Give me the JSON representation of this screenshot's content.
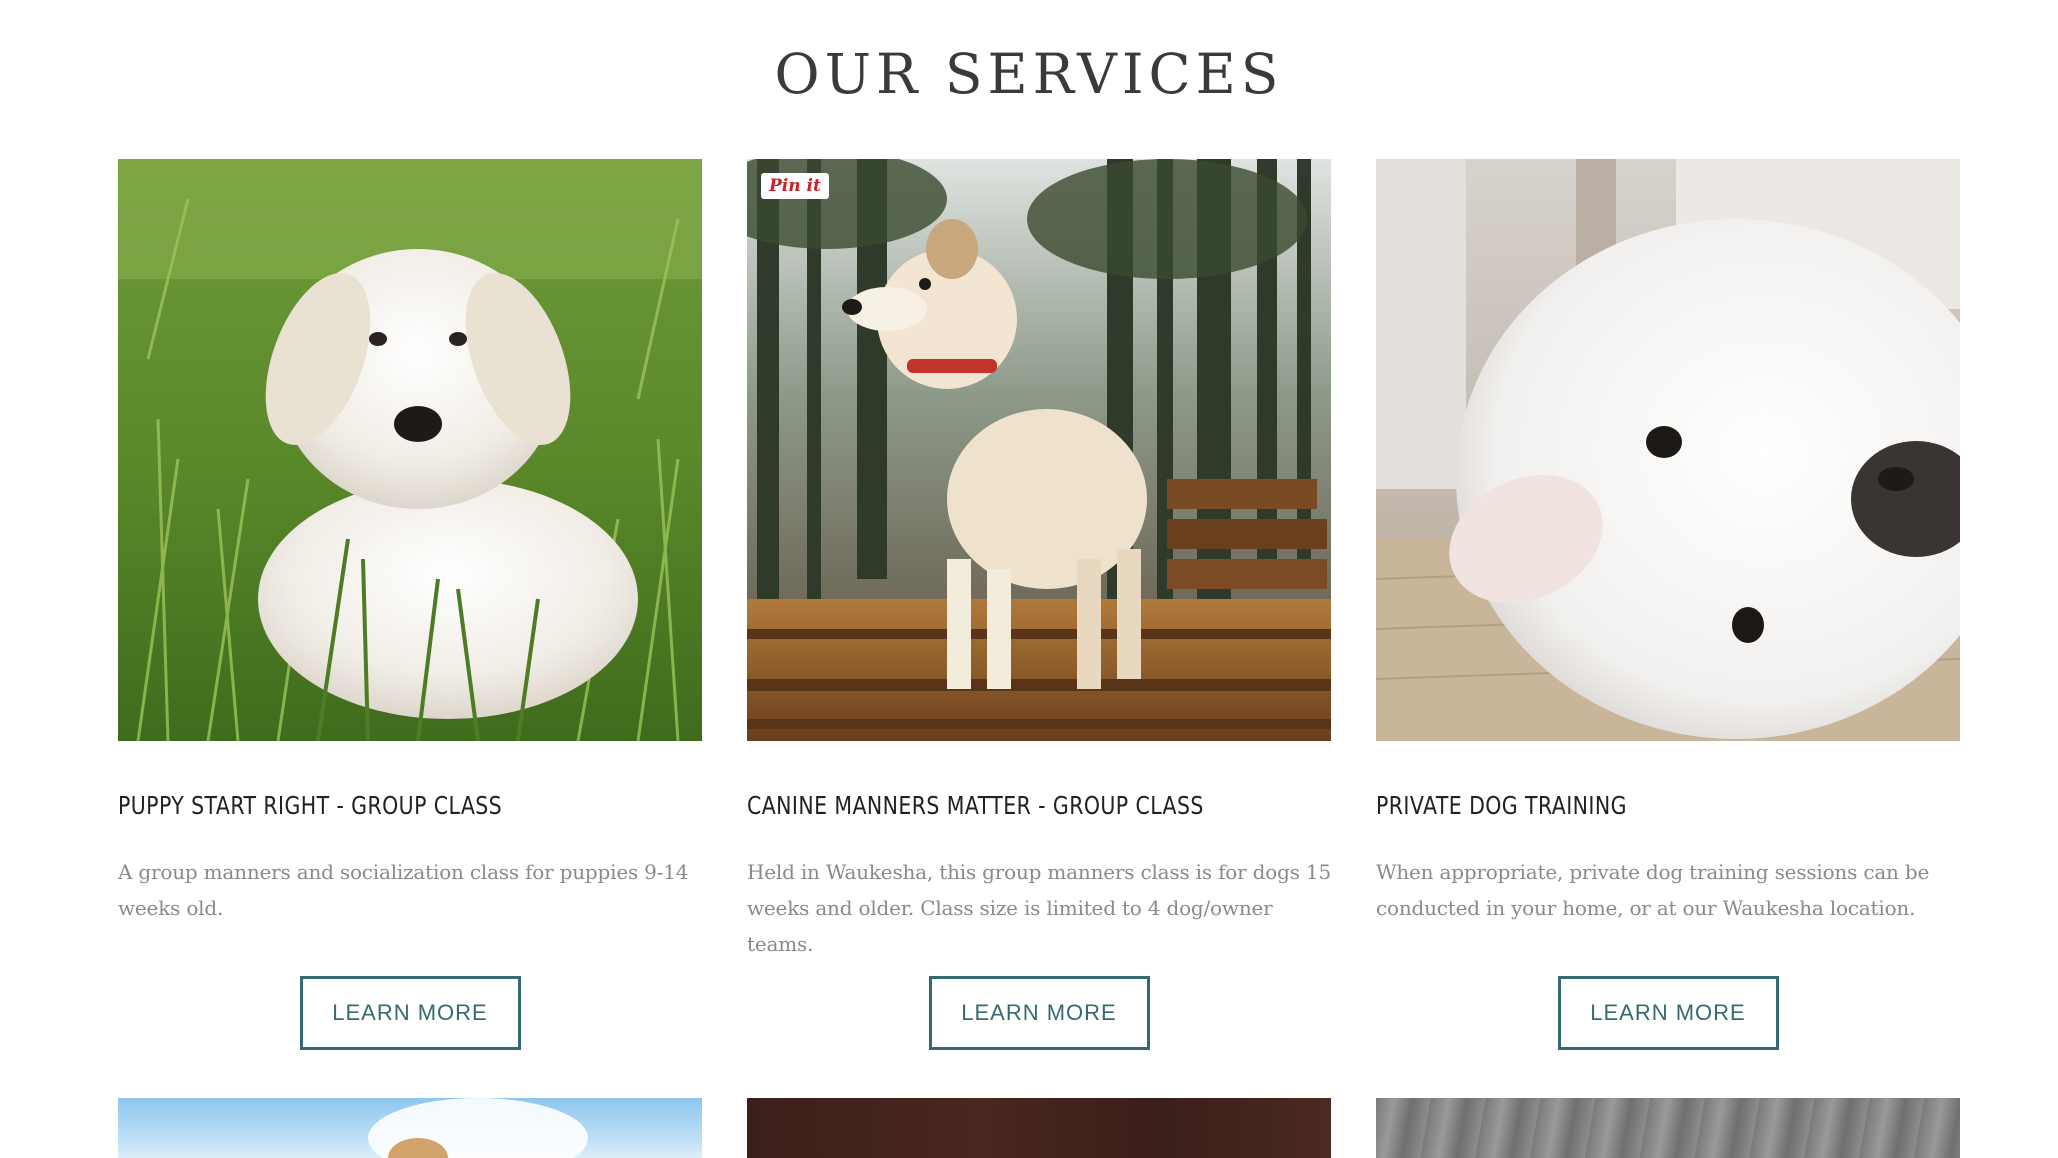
{
  "section": {
    "title": "OUR SERVICES"
  },
  "cards": [
    {
      "image_alt": "White golden retriever puppy lying in grass",
      "title": "PUPPY START RIGHT - GROUP CLASS",
      "description": "A group manners and socialization class for puppies 9-14 weeks old.",
      "button_label": "LEARN MORE"
    },
    {
      "image_alt": "Cream colored dog standing on logs in a forest",
      "pin_label": "Pin it",
      "title": "CANINE MANNERS MATTER - GROUP CLASS",
      "description": "Held in Waukesha, this group manners class is for dogs 15 weeks and older. Class size is limited to 4 dog/owner teams.",
      "button_label": "LEARN MORE"
    },
    {
      "image_alt": "Fluffy white dog lying on its side on a wooden floor",
      "title": "PRIVATE DOG TRAINING",
      "description": "When appropriate, private dog training sessions can be conducted in your home, or at our Waukesha location.",
      "button_label": "LEARN MORE"
    }
  ],
  "colors": {
    "accent": "#356a72",
    "heading": "#3a3a3a",
    "body_text": "#8a8a8a",
    "pinterest": "#cb2027"
  }
}
